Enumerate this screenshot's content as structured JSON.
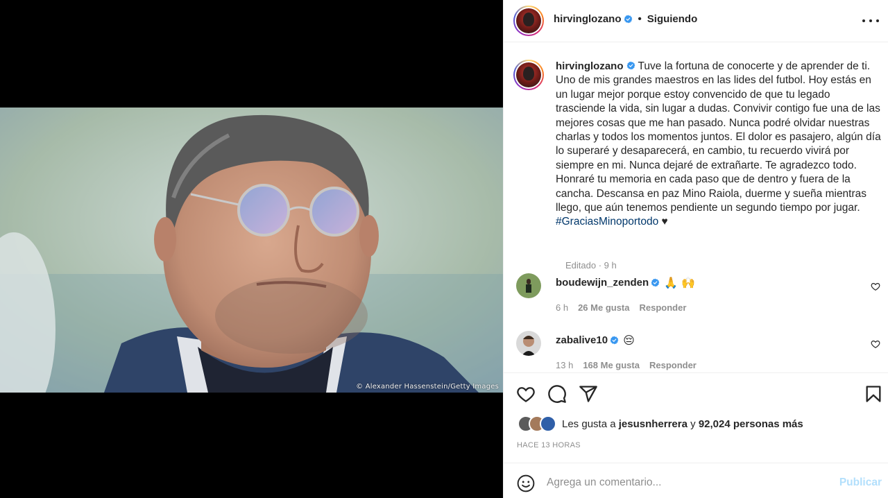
{
  "media": {
    "photo_credit": "© Alexander Hassenstein/Getty Images"
  },
  "header": {
    "username": "hirvinglozano",
    "separator": "•",
    "following_label": "Siguiendo"
  },
  "caption": {
    "username": "hirvinglozano",
    "text": "Tuve la fortuna de conocerte y de aprender de ti. Uno de mis grandes maestros en las lides del futbol. Hoy estás en un lugar mejor porque estoy convencido de que tu legado trasciende la vida, sin lugar a dudas. Convivir contigo fue una de las mejores cosas que me han pasado. Nunca podré olvidar nuestras charlas y todos los momentos juntos. El dolor es pasajero, algún día lo superaré y desaparecerá, en cambio, tu recuerdo vivirá por siempre en mi. Nunca dejaré de extrañarte. Te agradezco todo. Honraré tu memoria en cada paso que de dentro y fuera de la cancha. Descansa en paz Mino Raiola, duerme y sueña mientras llego, que aún tenemos pendiente un segundo tiempo por jugar.",
    "hashtag": "#GraciasMinoportodo",
    "heart": "♥",
    "meta": "Editado · 9 h"
  },
  "comments": [
    {
      "username": "boudewijn_zenden",
      "emojis": "🙏 🙌",
      "time": "6 h",
      "likes": "26 Me gusta",
      "reply": "Responder"
    },
    {
      "username": "zabalive10",
      "emojis": "😔",
      "time": "13 h",
      "likes": "168 Me gusta",
      "reply": "Responder"
    }
  ],
  "likes": {
    "prefix": "Les gusta a",
    "user": "jesusnherrera",
    "connector": "y",
    "others": "92,024 personas más"
  },
  "time_ago": "HACE 13 HORAS",
  "add_comment": {
    "placeholder": "Agrega un comentario...",
    "publish_label": "Publicar"
  },
  "icons": {
    "like": "heart-icon",
    "comment": "comment-icon",
    "share": "paper-plane-icon",
    "save": "bookmark-icon",
    "emoji": "smile-icon",
    "verified": "verified-badge-icon",
    "more": "more-options-icon"
  },
  "colors": {
    "verified": "#3897f0",
    "link": "#00376b",
    "muted": "#8e8e8e",
    "publish_disabled": "#b2dffc"
  }
}
